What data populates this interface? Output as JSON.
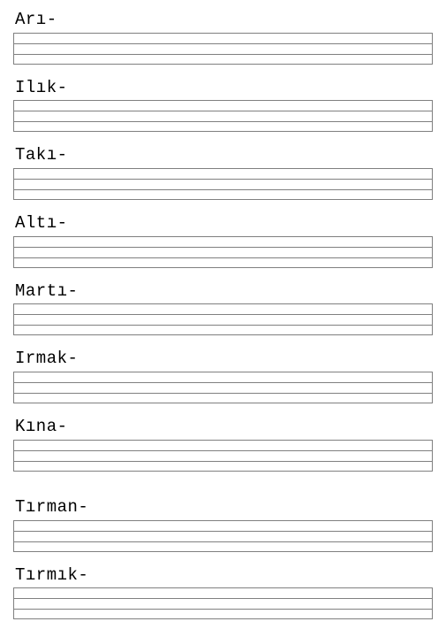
{
  "words": [
    "Arı-",
    "Ilık-",
    "Takı-",
    "Altı-",
    "Martı-",
    "Irmak-",
    "Kına-",
    "Tırman-",
    "Tırmık-"
  ]
}
